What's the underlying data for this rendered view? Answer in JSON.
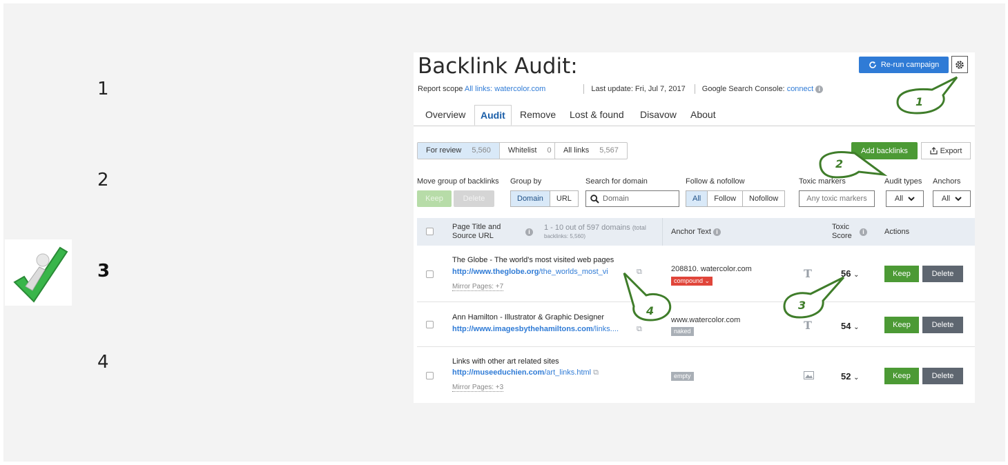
{
  "steps": [
    {
      "num": "1",
      "active": false
    },
    {
      "num": "2",
      "active": false
    },
    {
      "num": "3",
      "active": true
    },
    {
      "num": "4",
      "active": false
    }
  ],
  "header": {
    "title": "Backlink Audit:",
    "report_scope_label": "Report scope",
    "report_scope_value": "All links: watercolor.com",
    "last_update": "Last update: Fri, Jul 7, 2017",
    "gsc_label": "Google Search Console:",
    "gsc_link": "connect",
    "rerun_label": "Re-run campaign"
  },
  "tabs": [
    "Overview",
    "Audit",
    "Remove",
    "Lost & found",
    "Disavow",
    "About"
  ],
  "active_tab": "Audit",
  "segments": {
    "for_review": {
      "label": "For review",
      "count": "5,560"
    },
    "whitelist": {
      "label": "Whitelist",
      "count": "0"
    },
    "all_links": {
      "label": "All links",
      "count": "5,567"
    }
  },
  "actions": {
    "add_backlinks": "Add backlinks",
    "export": "Export"
  },
  "filters": {
    "move_group_label": "Move group of backlinks",
    "keep": "Keep",
    "delete": "Delete",
    "group_by_label": "Group by",
    "group_domain": "Domain",
    "group_url": "URL",
    "search_label": "Search for domain",
    "search_placeholder": "Domain",
    "follow_label": "Follow & nofollow",
    "follow_all": "All",
    "follow_follow": "Follow",
    "follow_nofollow": "Nofollow",
    "toxic_label": "Toxic markers",
    "toxic_value": "Any toxic markers",
    "audit_types_label": "Audit types",
    "audit_types_value": "All",
    "anchors_label": "Anchors",
    "anchors_value": "All"
  },
  "table": {
    "col_page": "Page Title and Source URL",
    "col_page_line1": "Page Title and",
    "col_page_line2": "Source URL",
    "count_text": "1 - 10 out of 597 domains",
    "count_total": "(total",
    "count_backlinks": "backlinks: 5,560)",
    "col_anchor": "Anchor Text",
    "col_toxic_line1": "Toxic",
    "col_toxic_line2": "Score",
    "col_actions": "Actions",
    "rows": [
      {
        "title": "The Globe - The world's most visited web pages",
        "url_domain": "http://www.theglobe.org",
        "url_path": "/the_worlds_most_vi",
        "mirror": "Mirror Pages: +7",
        "anchor": "208810. watercolor.com",
        "tag": "compound",
        "tag_color": "#e0453a",
        "score": "56",
        "keep": "Keep",
        "delete": "Delete"
      },
      {
        "title": "Ann Hamilton - Illustrator & Graphic Designer",
        "url_domain": "http://www.imagesbythehamiltons.com",
        "url_path": "/links....",
        "mirror": "",
        "anchor": "www.watercolor.com",
        "tag": "naked",
        "tag_color": "#a9afb6",
        "score": "54",
        "keep": "Keep",
        "delete": "Delete"
      },
      {
        "title": "Links with other art related sites",
        "url_domain": "http://museeduchien.com",
        "url_path": "/art_links.html",
        "mirror": "Mirror Pages: +3",
        "anchor": "",
        "tag": "empty",
        "tag_color": "#a9afb6",
        "score": "52",
        "keep": "Keep",
        "delete": "Delete"
      }
    ]
  },
  "annotations": [
    "1",
    "2",
    "3",
    "4"
  ],
  "colors": {
    "accent": "#2f7bd6",
    "keep_green": "#4c9a35",
    "delete_gray": "#5e6670",
    "annotation_green": "#3f7d2a"
  }
}
